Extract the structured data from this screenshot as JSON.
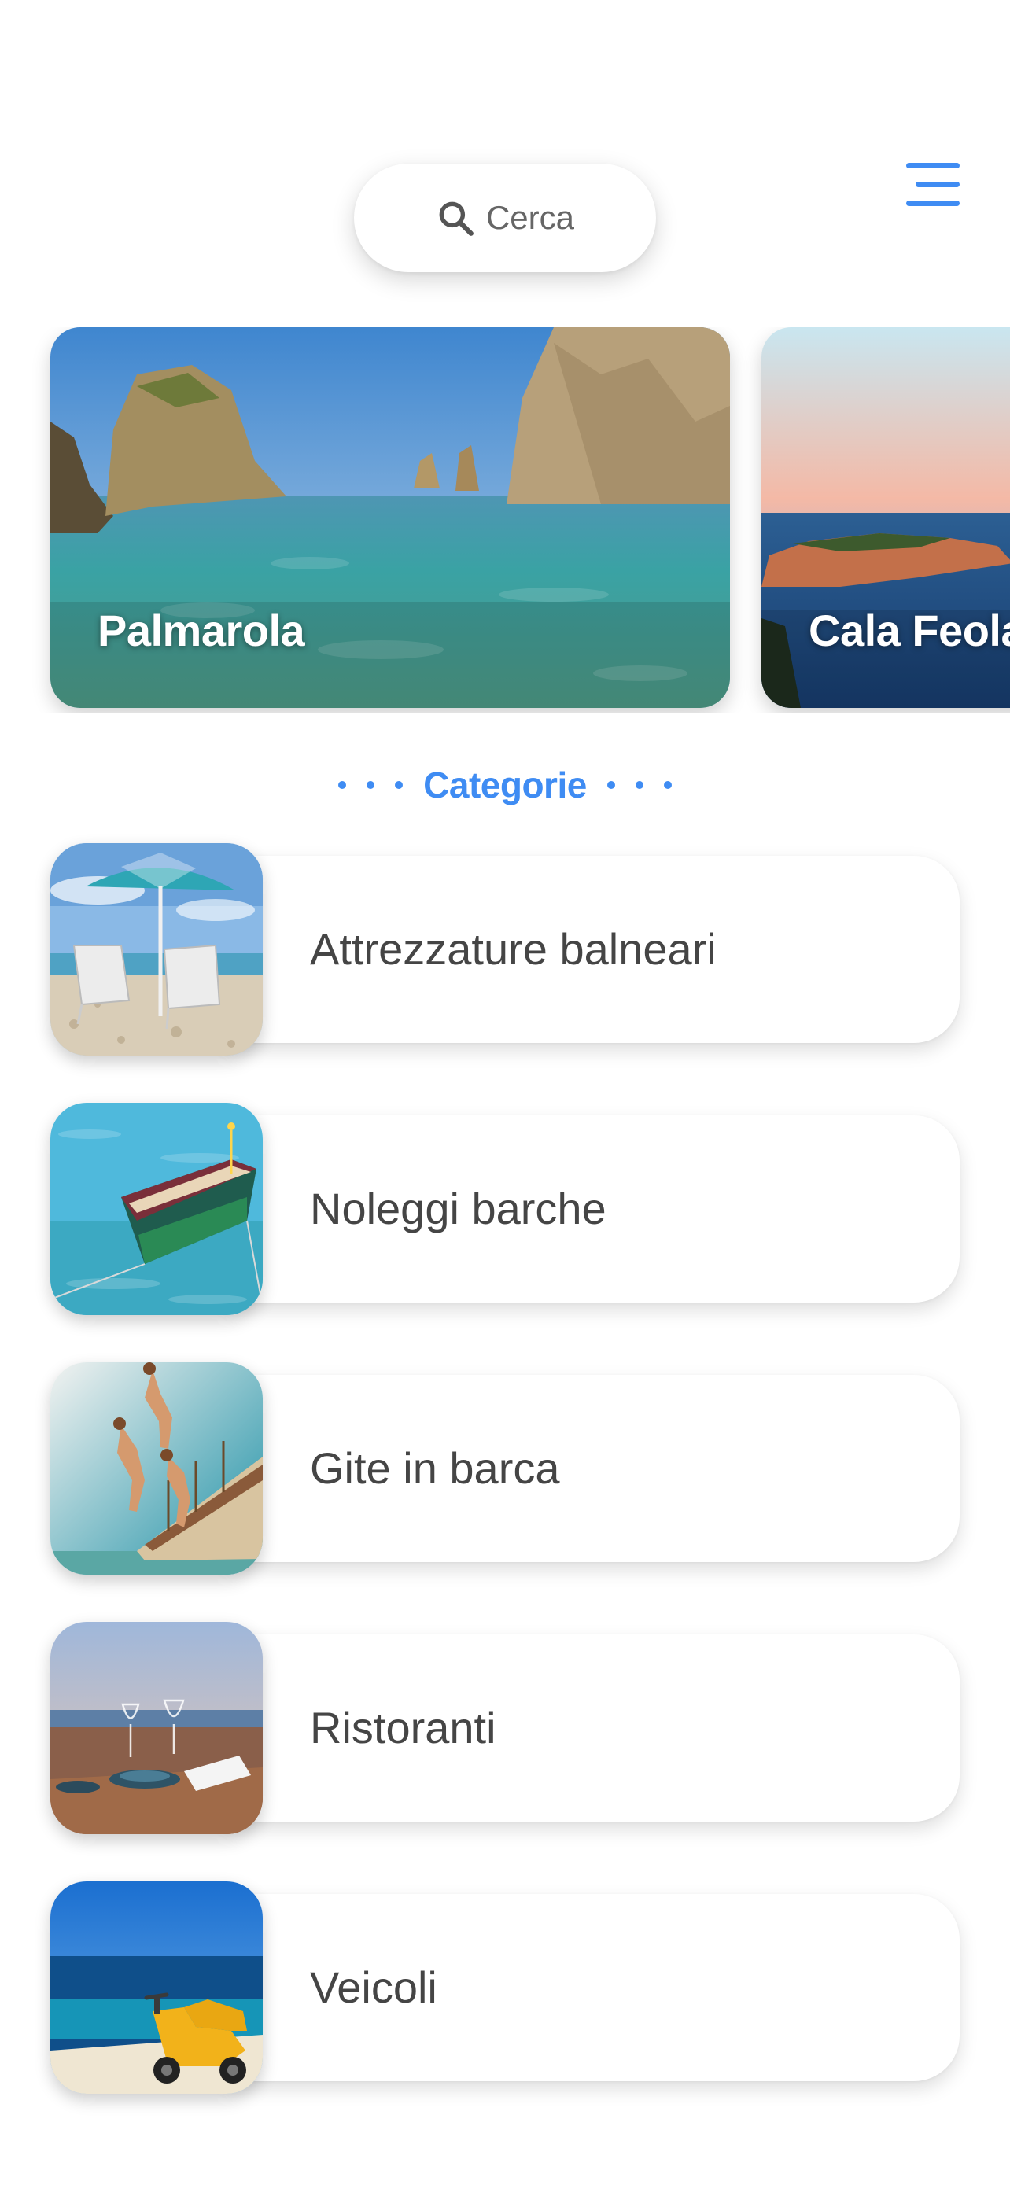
{
  "search": {
    "label": "Cerca",
    "icon": "search-icon"
  },
  "menu": {
    "icon": "hamburger-menu-icon",
    "color": "#3f8cf3"
  },
  "featured": [
    {
      "title": "Palmarola",
      "image": "sea-stacks-photo"
    },
    {
      "title": "Cala Feola",
      "image": "sunset-cove-photo"
    }
  ],
  "categories_header": {
    "title": "Categorie",
    "color": "#3f8cf3"
  },
  "categories": [
    {
      "label": "Attrezzature balneari",
      "image": "beach-umbrella-photo"
    },
    {
      "label": "Noleggi barche",
      "image": "rowing-boat-photo"
    },
    {
      "label": "Gite in barca",
      "image": "boat-diving-photo"
    },
    {
      "label": "Ristoranti",
      "image": "seaside-table-photo"
    },
    {
      "label": "Veicoli",
      "image": "scooter-photo"
    }
  ]
}
